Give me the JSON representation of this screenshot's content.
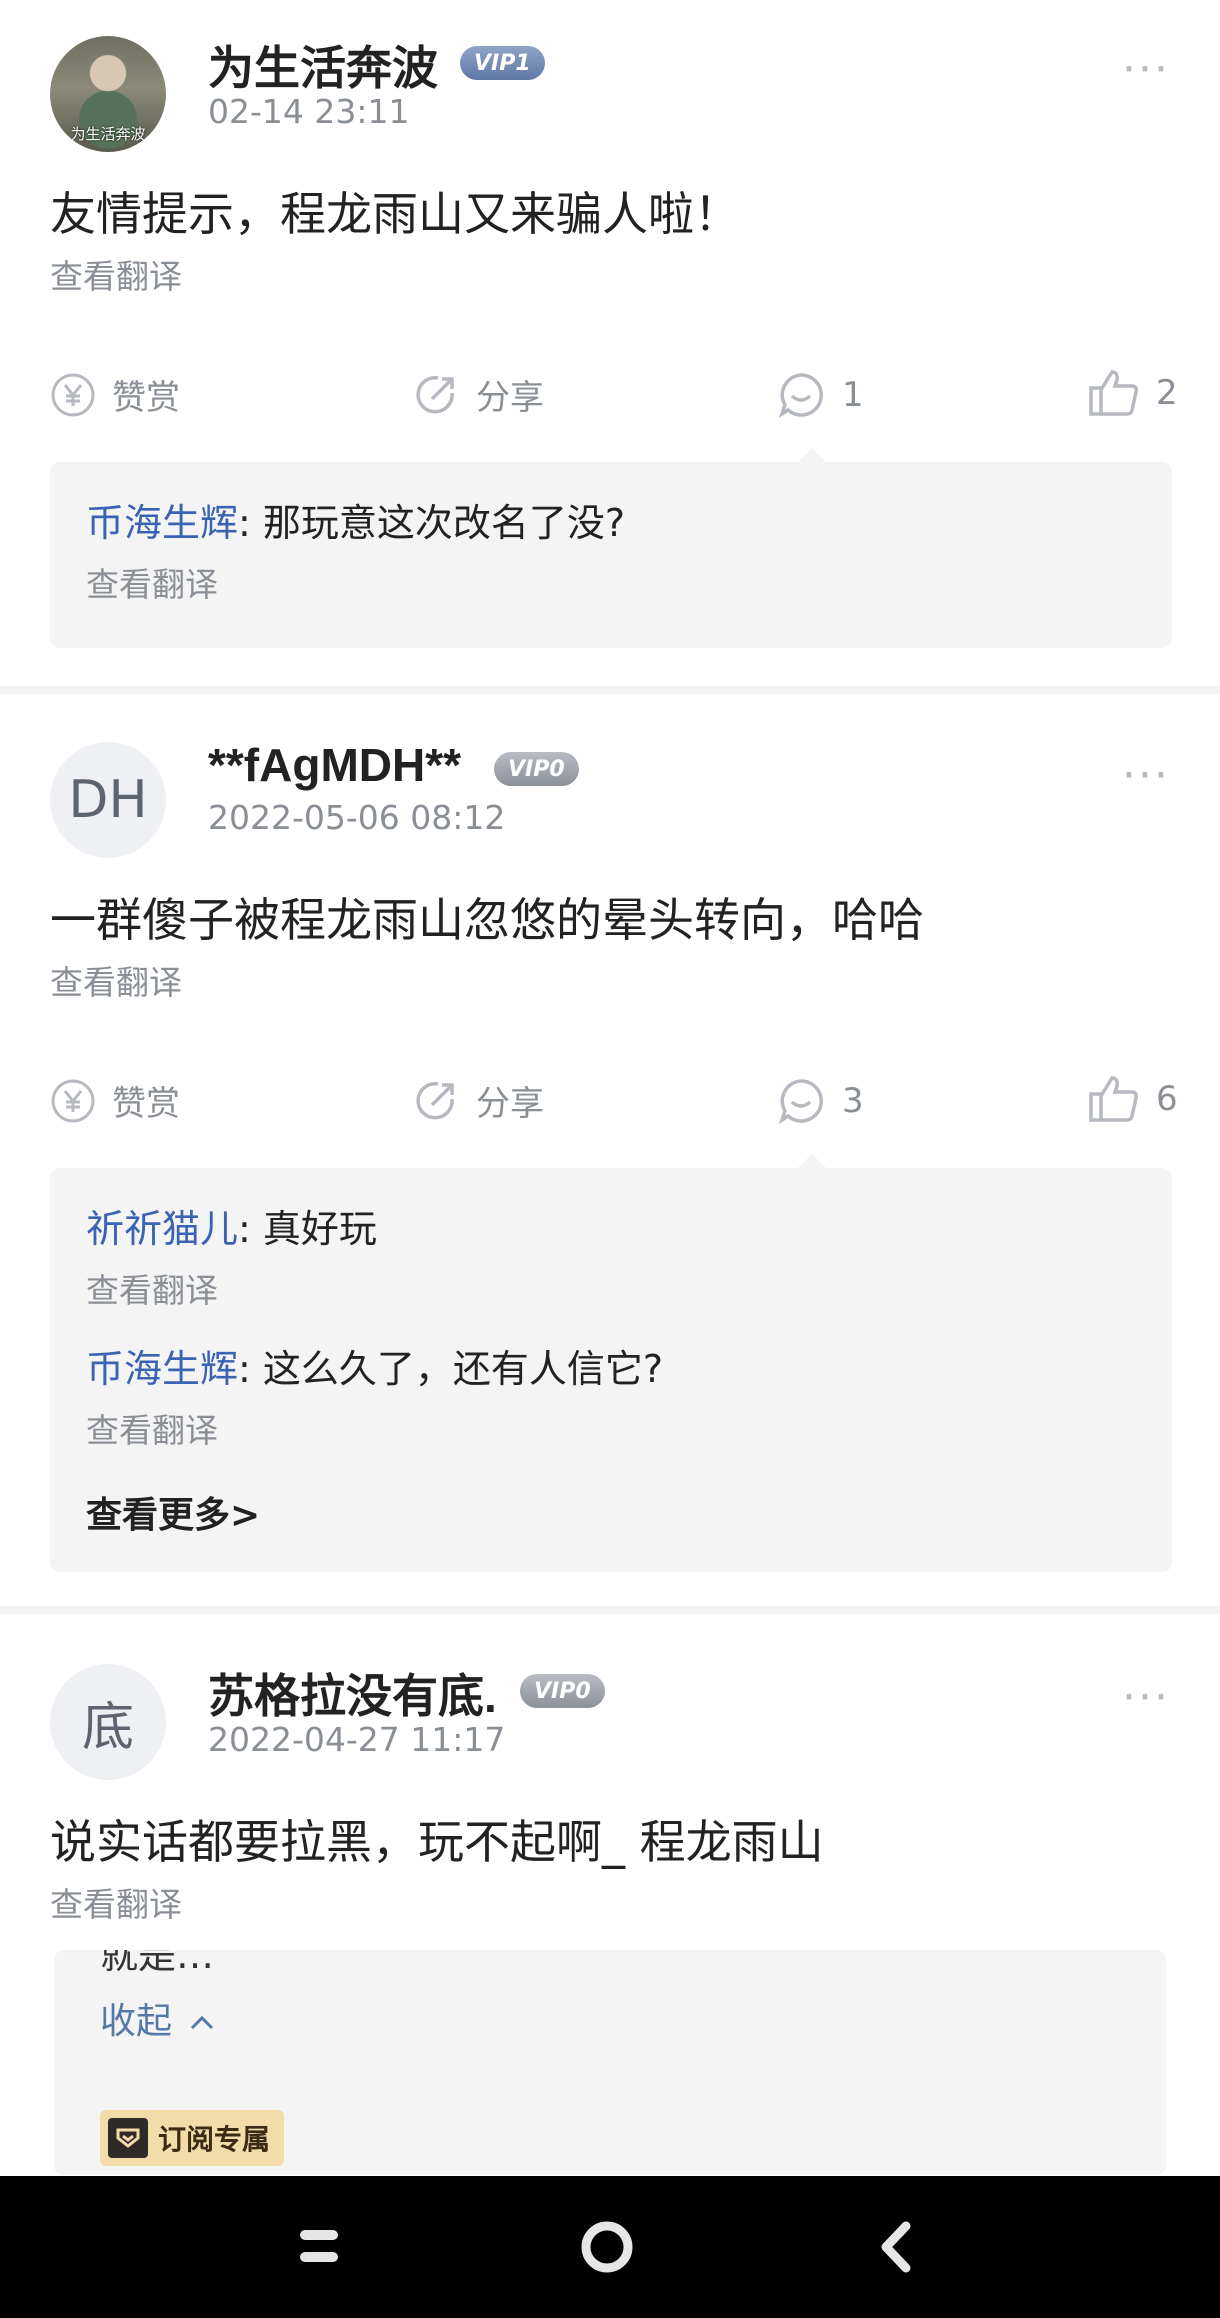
{
  "posts": [
    {
      "user": "为生活奔波",
      "avatar_text": "为生活奔波",
      "vip": "VIP1",
      "time": "02-14 23:11",
      "more": "···",
      "content": "友情提示，程龙雨山又来骗人啦！",
      "translate": "查看翻译",
      "actions": {
        "reward": "赞赏",
        "share": "分享",
        "comments": "1",
        "likes": "2"
      },
      "replies": [
        {
          "user": "币海生辉",
          "sep": ": ",
          "text": "那玩意这次改名了没?",
          "translate": "查看翻译"
        }
      ]
    },
    {
      "user": "**fAgMDH**",
      "avatar_text": "DH",
      "vip": "VIP0",
      "time": "2022-05-06 08:12",
      "more": "···",
      "content": "一群傻子被程龙雨山忽悠的晕头转向，哈哈",
      "translate": "查看翻译",
      "actions": {
        "reward": "赞赏",
        "share": "分享",
        "comments": "3",
        "likes": "6"
      },
      "replies": [
        {
          "user": "祈祈猫儿",
          "sep": ": ",
          "text": "真好玩",
          "translate": "查看翻译"
        },
        {
          "user": "币海生辉",
          "sep": ": ",
          "text": "这么久了，还有人信它?",
          "translate": "查看翻译"
        }
      ],
      "see_more": "查看更多>"
    },
    {
      "user": "苏格拉没有底.",
      "avatar_text": "底",
      "vip": "VIP0",
      "time": "2022-04-27 11:17",
      "more": "···",
      "content": "说实话都要拉黑，玩不起啊_ 程龙雨山",
      "translate": "查看翻译"
    }
  ],
  "overlay": {
    "cut_text": "就是…",
    "collapse": "收起",
    "subscribe_badge": "订阅专属"
  },
  "colors": {
    "link": "#3b63b3",
    "muted": "#8a8f96",
    "reply_bg": "#f4f4f5"
  }
}
